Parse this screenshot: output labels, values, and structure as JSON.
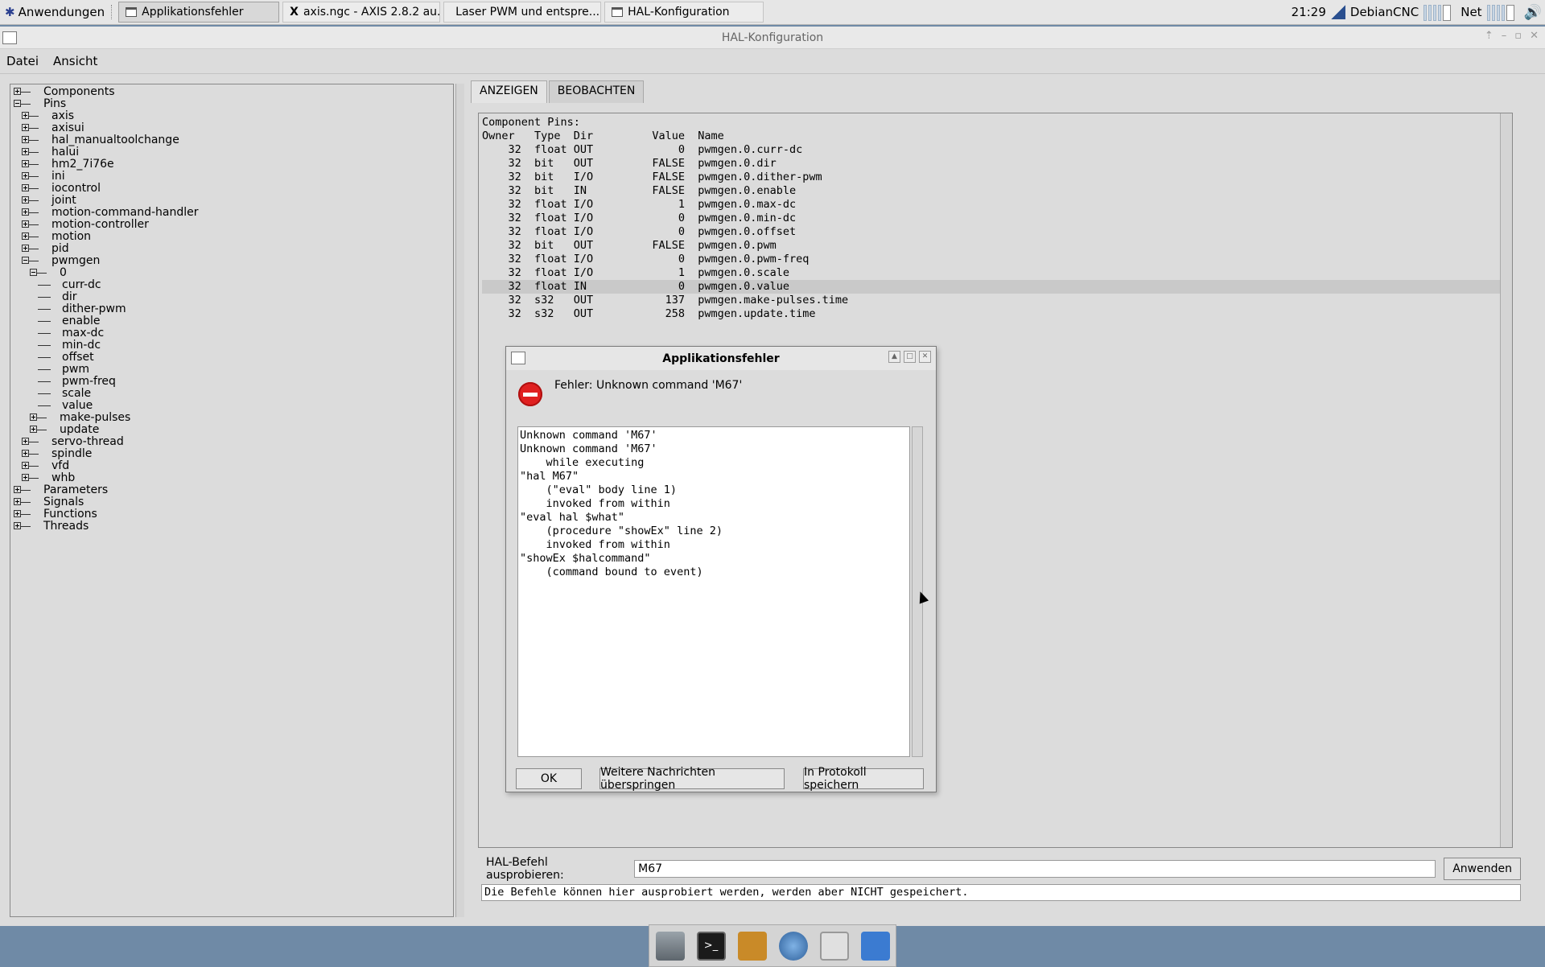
{
  "taskbar": {
    "start_label": "Anwendungen",
    "tasks": [
      {
        "label": "Applikationsfehler"
      },
      {
        "label": "axis.ngc - AXIS 2.8.2 au..."
      },
      {
        "label": "Laser PWM und entspre..."
      },
      {
        "label": "HAL-Konfiguration"
      }
    ],
    "clock": "21:29",
    "hostname": "DebianCNC",
    "net_label": "Net"
  },
  "window": {
    "title": "HAL-Konfiguration",
    "menu": [
      "Datei",
      "Ansicht"
    ]
  },
  "tree": {
    "items": [
      "Components",
      "Pins",
      "axis",
      "axisui",
      "hal_manualtoolchange",
      "halui",
      "hm2_7i76e",
      "ini",
      "iocontrol",
      "joint",
      "motion-command-handler",
      "motion-controller",
      "motion",
      "pid",
      "pwmgen",
      "0",
      "curr-dc",
      "dir",
      "dither-pwm",
      "enable",
      "max-dc",
      "min-dc",
      "offset",
      "pwm",
      "pwm-freq",
      "scale",
      "value",
      "make-pulses",
      "update",
      "servo-thread",
      "spindle",
      "vfd",
      "whb",
      "Parameters",
      "Signals",
      "Functions",
      "Threads"
    ]
  },
  "tabs": [
    "ANZEIGEN",
    "BEOBACHTEN"
  ],
  "pins": {
    "heading": "Component Pins:",
    "header": "Owner   Type  Dir         Value  Name",
    "rows": [
      "    32  float OUT             0  pwmgen.0.curr-dc",
      "    32  bit   OUT         FALSE  pwmgen.0.dir",
      "    32  bit   I/O         FALSE  pwmgen.0.dither-pwm",
      "    32  bit   IN          FALSE  pwmgen.0.enable",
      "    32  float I/O             1  pwmgen.0.max-dc",
      "    32  float I/O             0  pwmgen.0.min-dc",
      "    32  float I/O             0  pwmgen.0.offset",
      "    32  bit   OUT         FALSE  pwmgen.0.pwm",
      "    32  float I/O             0  pwmgen.0.pwm-freq",
      "    32  float I/O             1  pwmgen.0.scale",
      "    32  float IN              0  pwmgen.0.value",
      "    32  s32   OUT           137  pwmgen.make-pulses.time",
      "    32  s32   OUT           258  pwmgen.update.time"
    ]
  },
  "command": {
    "label": "HAL-Befehl ausprobieren:",
    "value": "M67",
    "apply_label": "Anwenden",
    "status": "Die Befehle können hier ausprobiert werden, werden aber NICHT gespeichert."
  },
  "dialog": {
    "title": "Applikationsfehler",
    "message": "Fehler: Unknown command 'M67'",
    "details": "Unknown command 'M67'\nUnknown command 'M67'\n    while executing\n\"hal M67\"\n    (\"eval\" body line 1)\n    invoked from within\n\"eval hal $what\"\n    (procedure \"showEx\" line 2)\n    invoked from within\n\"showEx $halcommand\"\n    (command bound to event)",
    "ok_label": "OK",
    "skip_label": "Weitere Nachrichten überspringen",
    "save_label": "In Protokoll speichern"
  },
  "colors": {
    "error_icon": "#e02020",
    "desktop": "#6f8aa6",
    "selection": "#c9c9c9"
  }
}
